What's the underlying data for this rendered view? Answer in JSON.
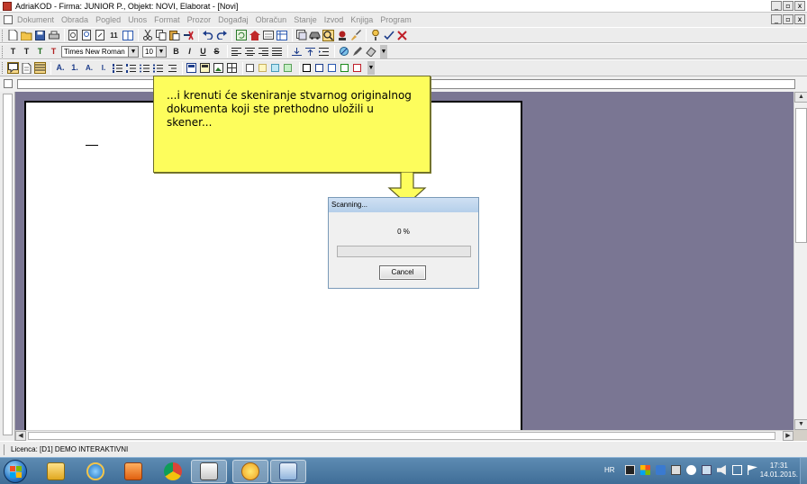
{
  "window": {
    "title": "AdriaKOD - Firma: JUNIOR P.,   Objekt: NOVI, Elaborat - [Novi]",
    "buttons": [
      "_",
      "▫",
      "x"
    ]
  },
  "menu": {
    "items": [
      "Dokument",
      "Obrada",
      "Pogled",
      "Unos",
      "Format",
      "Prozor",
      "Događaj",
      "Obračun",
      "Stanje",
      "Izvod",
      "Knjiga",
      "Program"
    ],
    "doc_buttons": [
      "_",
      "▫",
      "x"
    ]
  },
  "toolbar_format": {
    "text_buttons": [
      "T",
      "T",
      "T",
      "T"
    ],
    "font_name": "Times New Roman",
    "font_size": "10",
    "style_buttons": [
      "B",
      "I",
      "U",
      "S"
    ]
  },
  "toolbar_styles": {
    "heading_buttons": [
      "A.",
      "1.",
      "A.",
      "I."
    ]
  },
  "address_bar": {
    "value": ""
  },
  "callout": {
    "text": "...i krenuti će skeniranje stvarnog originalnog dokumenta koji ste prethodno uložili u skener..."
  },
  "scan_dialog": {
    "title": "Scanning...",
    "percent_label": "0 %",
    "progress": 0,
    "cancel_label": "Cancel"
  },
  "status": {
    "text": "Licenca: [D1] DEMO INTERAKTIVNI"
  },
  "taskbar": {
    "language": "HR",
    "time": "17:31",
    "date": "14.01.2015.",
    "apps": [
      "file-explorer-icon",
      "internet-explorer-icon",
      "media-player-icon",
      "chrome-icon",
      "adriakod-icon",
      "sun-app-icon",
      "network-app-icon"
    ]
  },
  "colors": {
    "workspace": "#7a7693",
    "callout": "#fdfd5c",
    "progress": "#3aa635"
  }
}
